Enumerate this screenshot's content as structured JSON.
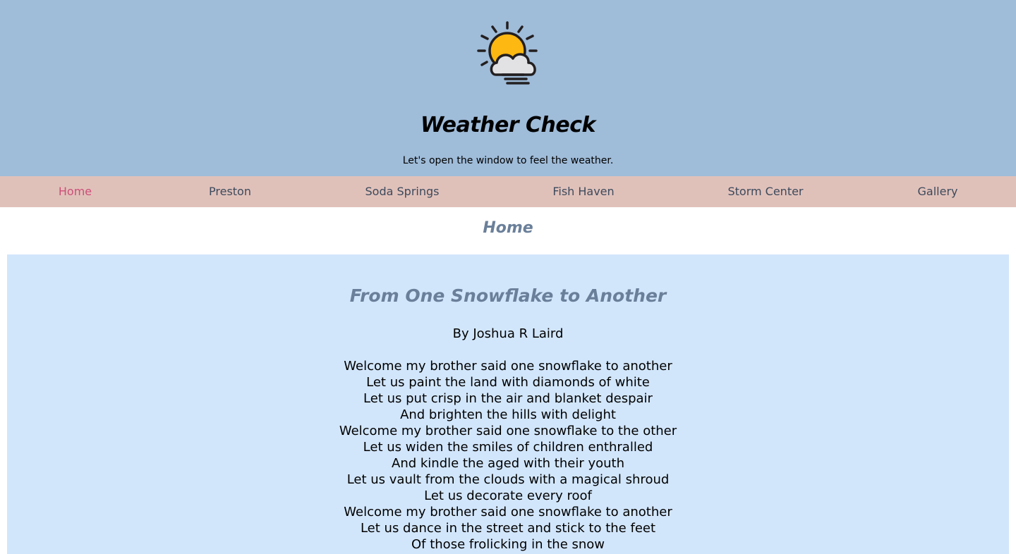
{
  "header": {
    "logo_icon": "sun-behind-cloud-icon",
    "title": "Weather Check",
    "tagline": "Let's open the window to feel the weather.",
    "background": "#9fbcd9"
  },
  "nav": {
    "background": "#e0c1ba",
    "active_color": "#cc4f78",
    "items": [
      {
        "label": "Home",
        "active": true
      },
      {
        "label": "Preston",
        "active": false
      },
      {
        "label": "Soda Springs",
        "active": false
      },
      {
        "label": "Fish Haven",
        "active": false
      },
      {
        "label": "Storm Center",
        "active": false
      },
      {
        "label": "Gallery",
        "active": false
      }
    ]
  },
  "main": {
    "page_heading": "Home",
    "heading_color": "#6a7f99",
    "panel_background": "#d2e6fb",
    "poem": {
      "title": "From One Snowflake to Another",
      "author": "By Joshua R Laird",
      "lines": [
        "Welcome my brother said one snowflake to another",
        "Let us paint the land with diamonds of white",
        "Let us put crisp in the air and blanket despair",
        "And brighten the hills with delight",
        "Welcome my brother said one snowflake to the other",
        "Let us widen the smiles of children enthralled",
        "And kindle the aged with their youth",
        "Let us vault from the clouds with a magical shroud",
        "Let us decorate every roof",
        "Welcome my brother said one snowflake to another",
        "Let us dance in the street and stick to the feet",
        "Of those frolicking in the snow"
      ]
    }
  }
}
